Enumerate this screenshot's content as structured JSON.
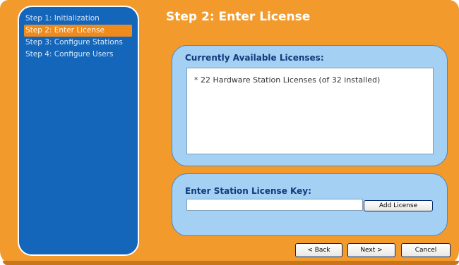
{
  "sidebar": {
    "items": [
      {
        "label": "Step 1: Initialization",
        "active": false
      },
      {
        "label": "Step 2: Enter License",
        "active": true
      },
      {
        "label": "Step 3: Configure Stations",
        "active": false
      },
      {
        "label": "Step 4: Configure Users",
        "active": false
      }
    ]
  },
  "main": {
    "title": "Step 2: Enter License",
    "licenses": {
      "heading": "Currently Available Licenses:",
      "items": [
        "* 22 Hardware Station Licenses (of 32 installed)"
      ]
    },
    "license_key": {
      "heading": "Enter Station License Key:",
      "value": "",
      "add_button_label": "Add License"
    }
  },
  "footer": {
    "back_label": "< Back",
    "next_label": "Next >",
    "cancel_label": "Cancel"
  },
  "colors": {
    "window_background": "#f39a2c",
    "sidebar_background": "#1466ba",
    "active_step_highlight": "#ef8a1c",
    "panel_background": "#a3d0f3",
    "panel_heading": "#113a7a"
  }
}
